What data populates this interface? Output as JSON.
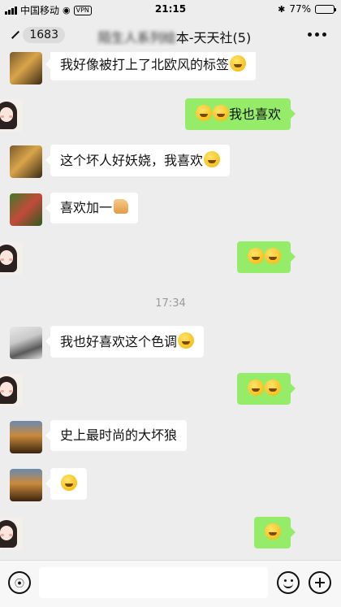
{
  "status_bar": {
    "carrier": "中国移动",
    "vpn": "VPN",
    "time": "21:15",
    "battery": "77%",
    "battery_level": 0.77
  },
  "header": {
    "back_count": "1683",
    "title_blurred": "陌生人系列绘",
    "title": "本-天天社(5)"
  },
  "messages": [
    {
      "side": "left",
      "avatar": "photo-warm",
      "text": "我好像被打上了北欧风的标签",
      "emoji": [
        "grin-emoji"
      ]
    },
    {
      "side": "right",
      "avatar": "girl",
      "text": "我也喜欢",
      "emoji_before": [
        "grin-emoji",
        "grin-emoji"
      ]
    },
    {
      "side": "left",
      "avatar": "photo-warm",
      "text": "这个坏人好妖娆，我喜欢",
      "emoji": [
        "heart-eyes-emoji"
      ]
    },
    {
      "side": "left",
      "avatar": "photo-green",
      "text": "喜欢加一",
      "emoji": [
        "thumbs-up-emoji"
      ]
    },
    {
      "side": "right",
      "avatar": "girl",
      "text": "",
      "emoji_before": [
        "tears-of-joy-emoji",
        "tears-of-joy-emoji"
      ]
    },
    {
      "side": "left",
      "avatar": "photo-grey",
      "text": "我也好喜欢这个色调",
      "emoji": [
        "smile-emoji"
      ]
    },
    {
      "side": "right",
      "avatar": "girl",
      "text": "",
      "emoji_before": [
        "kiss-emoji",
        "kiss-emoji"
      ]
    },
    {
      "side": "left",
      "avatar": "photo-desert",
      "text": "史上最时尚的大坏狼",
      "emoji": []
    },
    {
      "side": "left",
      "avatar": "photo-desert",
      "text": "",
      "emoji": [
        "grin-emoji"
      ]
    },
    {
      "side": "right",
      "avatar": "girl",
      "text": "",
      "emoji_before": [
        "rofl-emoji"
      ]
    }
  ],
  "timestamp": "17:34",
  "input": {
    "value": "",
    "placeholder": ""
  },
  "colors": {
    "background": "#ededed",
    "self_bubble": "#95ec69",
    "other_bubble": "#ffffff"
  }
}
